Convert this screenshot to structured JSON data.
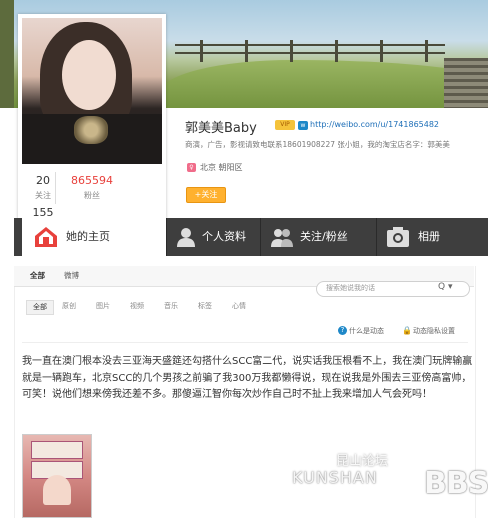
{
  "profile": {
    "name": "郭美美Baby",
    "vip_badge": "VIP",
    "url": "http://weibo.com/u/1741865482",
    "bio": "商演，广告，影视请致电联系18601908227 张小姐，我的淘宝店名字：郭美美",
    "location": "北京 朝阳区",
    "follow_button": "+关注",
    "stats": {
      "following_count": "20",
      "following_label": "关注",
      "fans_count": "865594",
      "fans_label": "粉丝",
      "weibo_count": "155"
    }
  },
  "tabs": [
    {
      "label": "她的主页",
      "icon": "home-icon"
    },
    {
      "label": "个人资料",
      "icon": "person-icon"
    },
    {
      "label": "关注/粉丝",
      "icon": "people-icon"
    },
    {
      "label": "相册",
      "icon": "camera-icon"
    }
  ],
  "feed": {
    "subtabs": [
      "全部",
      "微博"
    ],
    "search_placeholder": "搜索她说我的话",
    "filters": [
      "全部",
      "原创",
      "图片",
      "视频",
      "音乐",
      "标签",
      "心情"
    ],
    "help_text": "什么是动态",
    "privacy_text": "动态隐私设置",
    "post_text": "我一直在澳门根本没去三亚海天盛筵还勾搭什么SCC富二代，说实话我压根看不上，我在澳门玩牌输赢就是一辆跑车，北京SCC的几个男孩之前骗了我300万我都懒得说，现在说我是外围去三亚傍高富帅，可笑！说他们想来傍我还差不多。那傻逼江智你每次炒作自己时不扯上我来增加人气会死吗！"
  },
  "watermark": {
    "cn": "昆山论坛",
    "en": "KUNSHAN",
    "logo": "BBS"
  },
  "colors": {
    "tab_bar": "#3e3e3e",
    "accent_red": "#e8413c",
    "follow_button": "#ffb12f",
    "link": "#1e6fb8"
  }
}
